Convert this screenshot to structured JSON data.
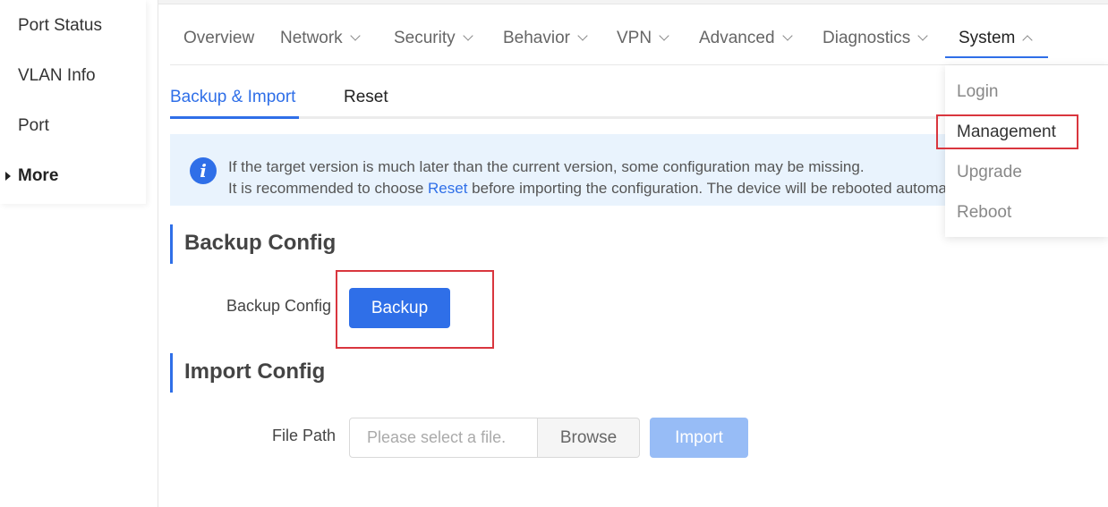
{
  "sidebar": {
    "items": [
      {
        "label": "Port Status"
      },
      {
        "label": "VLAN Info"
      },
      {
        "label": "Port"
      },
      {
        "label": "More"
      }
    ]
  },
  "topnav": {
    "items": [
      {
        "label": "Overview"
      },
      {
        "label": "Network"
      },
      {
        "label": "Security"
      },
      {
        "label": "Behavior"
      },
      {
        "label": "VPN"
      },
      {
        "label": "Advanced"
      },
      {
        "label": "Diagnostics"
      },
      {
        "label": "System"
      }
    ],
    "active": "System"
  },
  "subtabs": {
    "items": [
      {
        "label": "Backup & Import"
      },
      {
        "label": "Reset"
      }
    ],
    "active": "Backup & Import"
  },
  "info": {
    "line1": "If the target version is much later than the current version, some configuration may be missing.",
    "line2_prefix": "It is recommended to choose ",
    "line2_link": "Reset",
    "line2_suffix": " before importing the configuration. The device will be rebooted automatically."
  },
  "backup": {
    "title": "Backup Config",
    "label": "Backup Config",
    "button": "Backup"
  },
  "import": {
    "title": "Import Config",
    "label": "File Path",
    "placeholder": "Please select a file.",
    "browse": "Browse",
    "button": "Import"
  },
  "system_menu": {
    "items": [
      {
        "label": "Login"
      },
      {
        "label": "Management"
      },
      {
        "label": "Upgrade"
      },
      {
        "label": "Reboot"
      }
    ]
  },
  "colors": {
    "accent": "#2f6fe8",
    "highlight": "#d9363e",
    "info_bg": "#e9f3fd"
  }
}
